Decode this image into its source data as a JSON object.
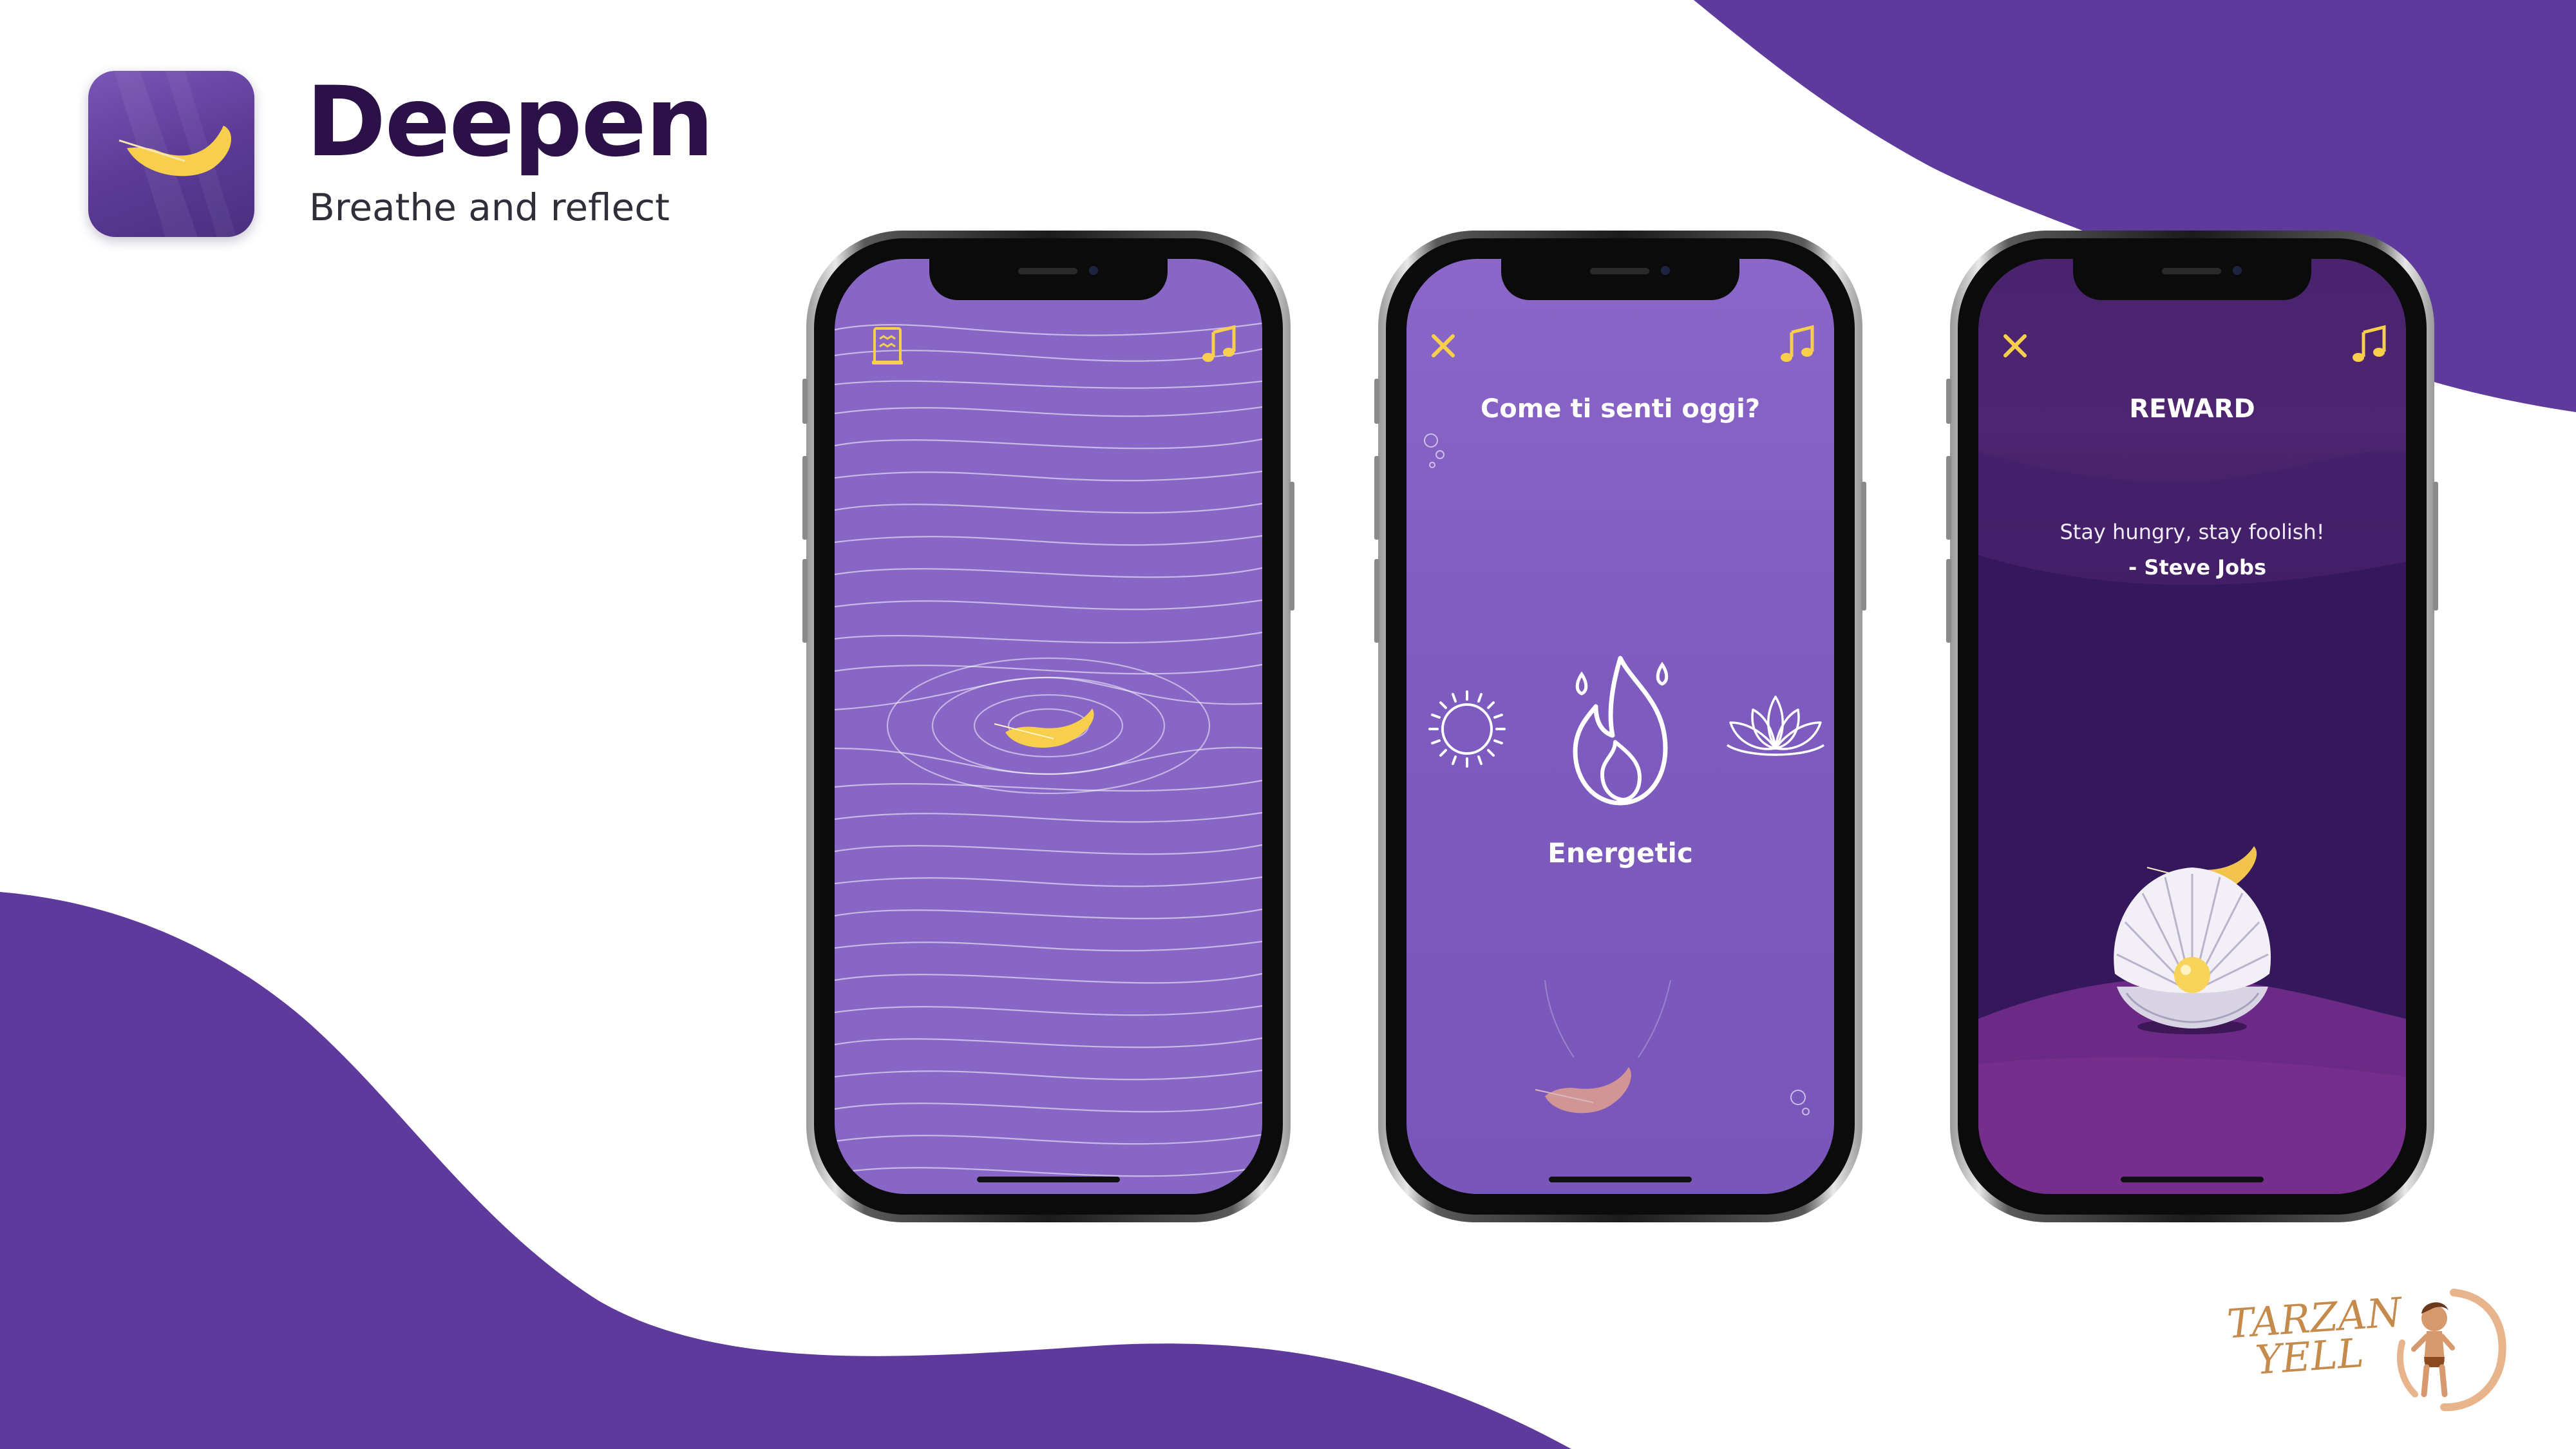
{
  "app": {
    "title": "Deepen",
    "subtitle": "Breathe and reflect"
  },
  "colors": {
    "brand_purple": "#5e3a9c",
    "deep_purple": "#2b1147",
    "feather_yellow": "#f7cf4c",
    "screen_lavender": "#8866c6"
  },
  "screens": [
    {
      "name": "pond",
      "top_left_icon": "journal-icon",
      "top_right_icon": "music-note-icon"
    },
    {
      "name": "mood",
      "close_icon": "close-icon",
      "music_icon": "music-note-icon",
      "question": "Come ti senti oggi?",
      "options": [
        "sun-icon",
        "flame-icon",
        "lotus-icon"
      ],
      "selected_label": "Energetic"
    },
    {
      "name": "reward",
      "close_icon": "close-icon",
      "music_icon": "music-note-icon",
      "title": "REWARD",
      "quote": "Stay hungry, stay foolish!",
      "author": "- Steve Jobs"
    }
  ],
  "credit": {
    "logo_line1": "TARZAN",
    "logo_line2": "YELL"
  }
}
